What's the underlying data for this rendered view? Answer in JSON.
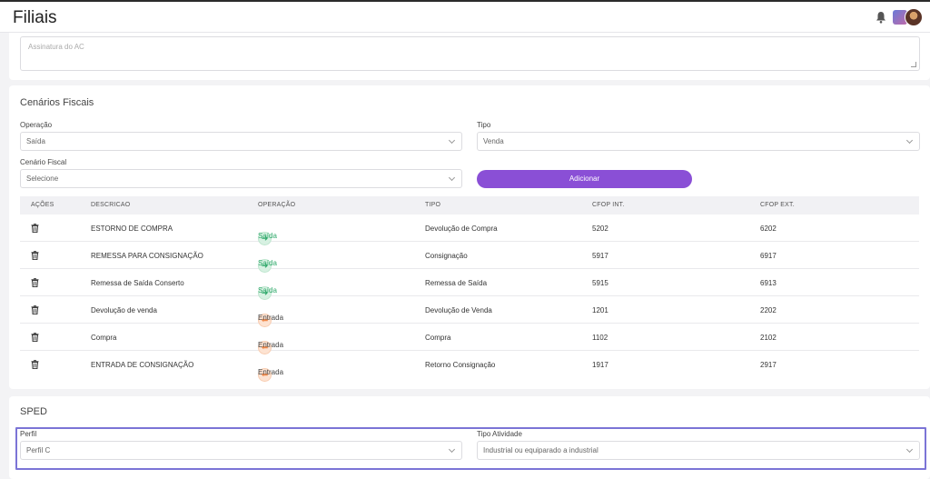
{
  "header": {
    "title": "Filiais"
  },
  "assinatura": {
    "placeholder": "Assinatura do AC"
  },
  "cenarios": {
    "title": "Cenários Fiscais",
    "operacao_label": "Operação",
    "operacao_value": "Saída",
    "tipo_label": "Tipo",
    "tipo_value": "Venda",
    "cenario_label": "Cenário Fiscal",
    "cenario_value": "Selecione",
    "add_label": "Adicionar",
    "columns": [
      "AÇÕES",
      "DESCRICAO",
      "OPERAÇÃO",
      "TIPO",
      "CFOP INT.",
      "CFOP EXT."
    ],
    "rows": [
      {
        "descricao": "ESTORNO DE COMPRA",
        "operacao": "Saída",
        "op_kind": "saida",
        "tipo": "Devolução de Compra",
        "cfop_int": "5202",
        "cfop_ext": "6202"
      },
      {
        "descricao": "REMESSA PARA CONSIGNAÇÃO",
        "operacao": "Saída",
        "op_kind": "saida",
        "tipo": "Consignação",
        "cfop_int": "5917",
        "cfop_ext": "6917"
      },
      {
        "descricao": "Remessa de Saída Conserto",
        "operacao": "Saída",
        "op_kind": "saida",
        "tipo": "Remessa de Saída",
        "cfop_int": "5915",
        "cfop_ext": "6913"
      },
      {
        "descricao": "Devolução de venda",
        "operacao": "Entrada",
        "op_kind": "entrada",
        "tipo": "Devolução de Venda",
        "cfop_int": "1201",
        "cfop_ext": "2202"
      },
      {
        "descricao": "Compra",
        "operacao": "Entrada",
        "op_kind": "entrada",
        "tipo": "Compra",
        "cfop_int": "1102",
        "cfop_ext": "2102"
      },
      {
        "descricao": "ENTRADA DE CONSIGNAÇÃO",
        "operacao": "Entrada",
        "op_kind": "entrada",
        "tipo": "Retorno Consignação",
        "cfop_int": "1917",
        "cfop_ext": "2917"
      }
    ]
  },
  "sped": {
    "title": "SPED",
    "perfil_label": "Perfil",
    "perfil_value": "Perfil C",
    "atividade_label": "Tipo Atividade",
    "atividade_value": "Industrial ou equiparado a industrial"
  },
  "icons": {
    "bell": "bell-icon",
    "trash": "trash-icon",
    "saida": "arrow-right-circle-icon",
    "entrada": "arrow-left-circle-icon",
    "chevron": "chevron-down-icon"
  },
  "colors": {
    "accent": "#8a4fd6",
    "saida": "#2ea86a",
    "entrada": "#f08a4b",
    "focus_frame": "#7b74d6"
  }
}
